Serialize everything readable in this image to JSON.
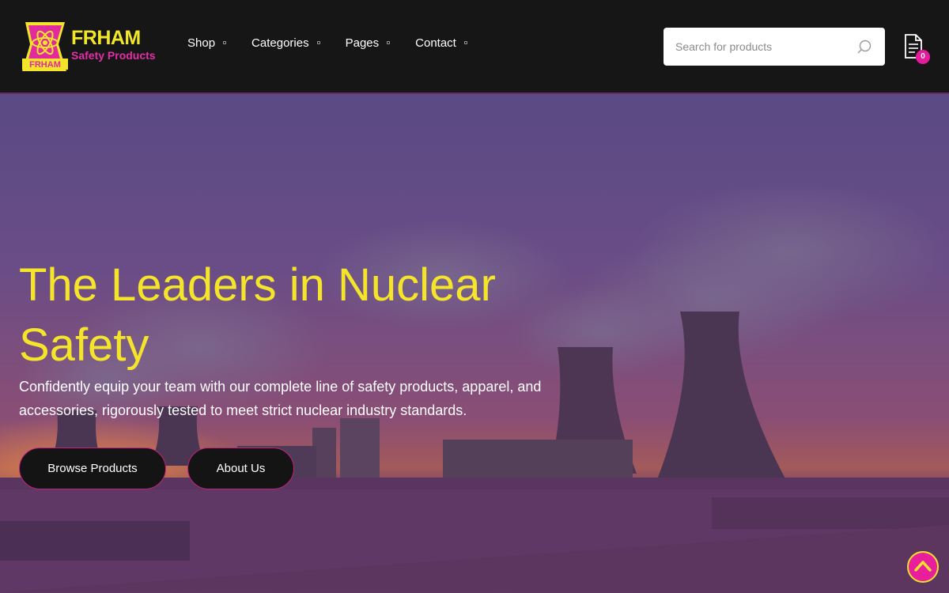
{
  "brand": {
    "name": "FRHAM",
    "tagline": "Safety Products",
    "badge_label": "FRHAM",
    "colors": {
      "yellow": "#f4e52a",
      "magenta": "#e51a9c",
      "dark": "#161616"
    }
  },
  "nav": {
    "items": [
      {
        "label": "Shop"
      },
      {
        "label": "Categories"
      },
      {
        "label": "Pages"
      },
      {
        "label": "Contact"
      }
    ]
  },
  "search": {
    "placeholder": "Search for products",
    "value": ""
  },
  "cart": {
    "count": "0",
    "icon": "document-icon"
  },
  "hero": {
    "title": "The Leaders in Nuclear Safety",
    "subtitle": "Confidently equip your team with our complete line of safety products, apparel, and accessories, rigorously tested to meet strict nuclear industry standards.",
    "buttons": {
      "browse": "Browse Products",
      "about": "About Us"
    }
  },
  "scroll_top": {
    "icon": "chevron-up-icon"
  }
}
